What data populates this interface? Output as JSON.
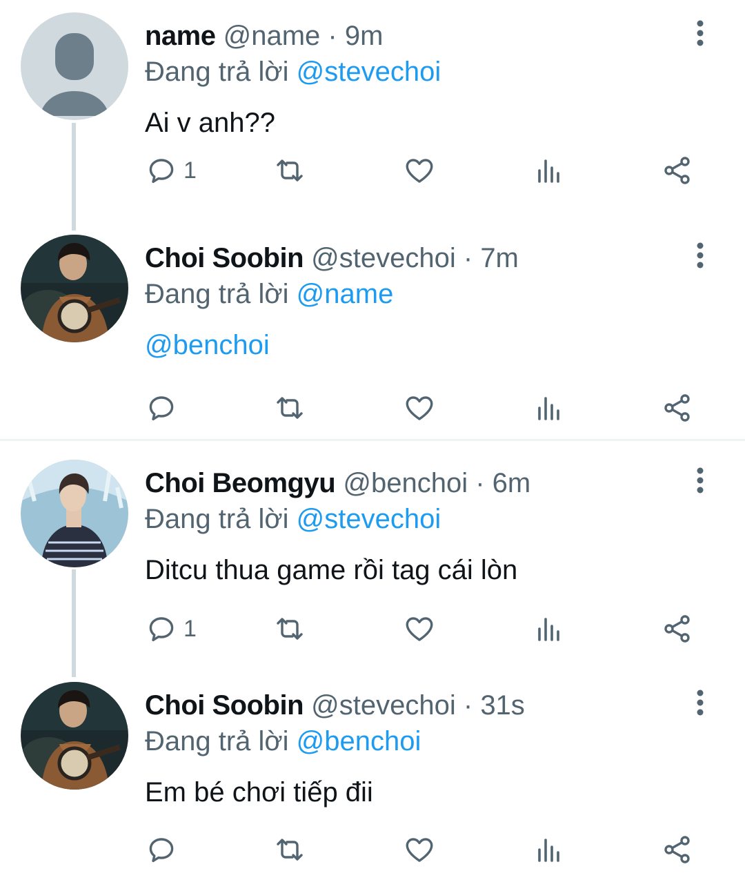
{
  "reply_prefix": "Đang trả lời",
  "colors": {
    "link": "#1d9bf0",
    "muted": "#536471",
    "thread_line": "#cfd9de"
  },
  "tweets": [
    {
      "name": "name",
      "handle": "@name",
      "separator": "·",
      "time": "9m",
      "replying_to": "@stevechoi",
      "text": "Ai v anh??",
      "reply_count": "1",
      "avatar": "default-avatar"
    },
    {
      "name": "Choi Soobin",
      "handle": "@stevechoi",
      "separator": "·",
      "time": "7m",
      "replying_to": "@name",
      "text": "@benchoi",
      "reply_count": "",
      "avatar": "soobin-photo"
    },
    {
      "name": "Choi Beomgyu",
      "handle": "@benchoi",
      "separator": "·",
      "time": "6m",
      "replying_to": "@stevechoi",
      "text": "Ditcu thua game rồi tag cái lòn",
      "reply_count": "1",
      "avatar": "beomgyu-photo"
    },
    {
      "name": "Choi Soobin",
      "handle": "@stevechoi",
      "separator": "·",
      "time": "31s",
      "replying_to": "@benchoi",
      "text": "Em bé chơi tiếp đii",
      "reply_count": "",
      "avatar": "soobin-photo"
    }
  ],
  "icons": {
    "reply": "reply-icon",
    "retweet": "retweet-icon",
    "like": "heart-icon",
    "views": "analytics-icon",
    "share": "share-icon",
    "more": "more-icon"
  }
}
